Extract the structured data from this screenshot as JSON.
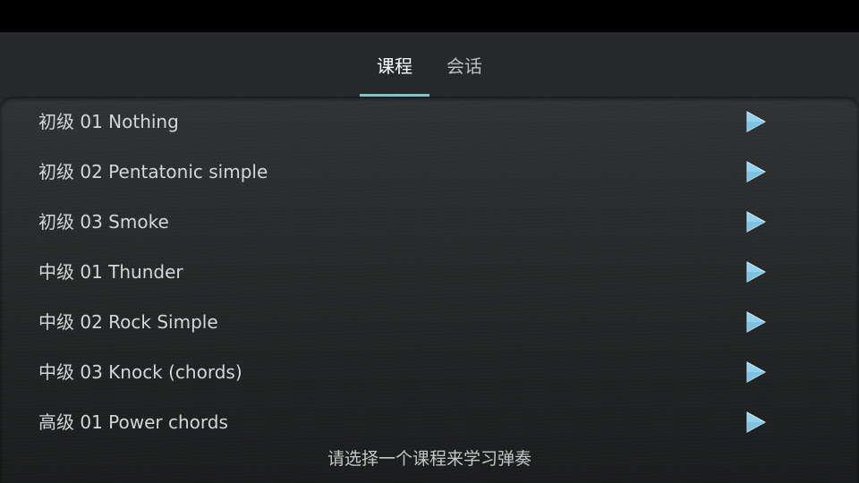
{
  "tabs": [
    {
      "label": "课程",
      "active": true
    },
    {
      "label": "会话",
      "active": false
    }
  ],
  "accent_color": "#7fc6cc",
  "play_icon_color": "#8fd3ee",
  "lessons": [
    {
      "label": "初级 01 Nothing",
      "icon": "play-icon"
    },
    {
      "label": "初级 02 Pentatonic simple",
      "icon": "play-icon"
    },
    {
      "label": "初级 03 Smoke",
      "icon": "play-icon"
    },
    {
      "label": "中级 01 Thunder",
      "icon": "play-icon"
    },
    {
      "label": "中级 02 Rock Simple",
      "icon": "play-icon"
    },
    {
      "label": "中级 03 Knock (chords)",
      "icon": "play-icon"
    },
    {
      "label": "高级 01 Power chords",
      "icon": "play-icon"
    }
  ],
  "hint": "请选择一个课程来学习弹奏"
}
